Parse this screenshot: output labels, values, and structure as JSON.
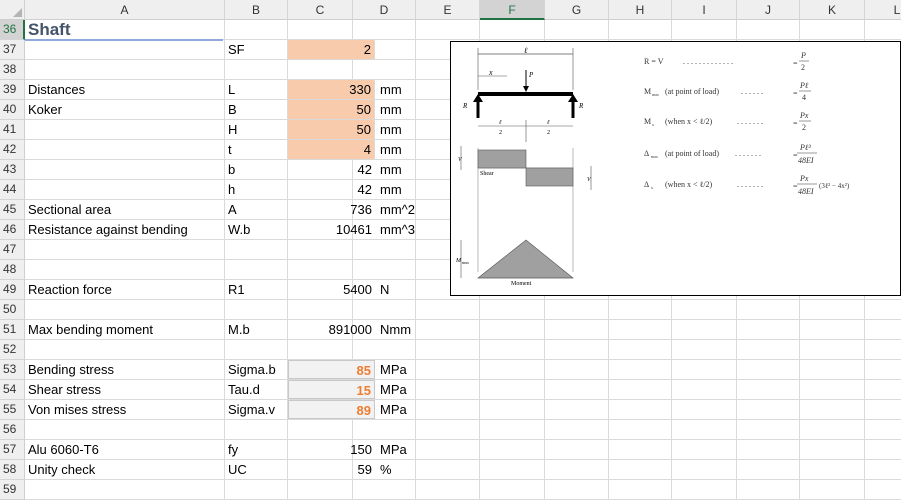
{
  "columns": [
    "A",
    "B",
    "C",
    "D",
    "E",
    "F",
    "G",
    "H",
    "I",
    "J",
    "K",
    "L"
  ],
  "selected_column": "F",
  "selected_row": "36",
  "rows": [
    {
      "num": "36",
      "a": "Shaft",
      "b": "",
      "c": "",
      "d": ""
    },
    {
      "num": "37",
      "a": "",
      "b": "SF",
      "c": "2",
      "d": ""
    },
    {
      "num": "38",
      "a": "",
      "b": "",
      "c": "",
      "d": ""
    },
    {
      "num": "39",
      "a": "Distances",
      "b": "L",
      "c": "330",
      "d": "mm"
    },
    {
      "num": "40",
      "a": "Koker",
      "b": "B",
      "c": "50",
      "d": "mm"
    },
    {
      "num": "41",
      "a": "",
      "b": "H",
      "c": "50",
      "d": "mm"
    },
    {
      "num": "42",
      "a": "",
      "b": "t",
      "c": "4",
      "d": "mm"
    },
    {
      "num": "43",
      "a": "",
      "b": "b",
      "c": "42",
      "d": "mm"
    },
    {
      "num": "44",
      "a": "",
      "b": "h",
      "c": "42",
      "d": "mm"
    },
    {
      "num": "45",
      "a": "Sectional area",
      "b": "A",
      "c": "736",
      "d": "mm^2"
    },
    {
      "num": "46",
      "a": "Resistance against bending",
      "b": "W.b",
      "c": "10461",
      "d": "mm^3"
    },
    {
      "num": "47",
      "a": "",
      "b": "",
      "c": "",
      "d": ""
    },
    {
      "num": "48",
      "a": "",
      "b": "",
      "c": "",
      "d": ""
    },
    {
      "num": "49",
      "a": "Reaction force",
      "b": "R1",
      "c": "5400",
      "d": "N"
    },
    {
      "num": "50",
      "a": "",
      "b": "",
      "c": "",
      "d": ""
    },
    {
      "num": "51",
      "a": "Max bending moment",
      "b": "M.b",
      "c": "891000",
      "d": "Nmm"
    },
    {
      "num": "52",
      "a": "",
      "b": "",
      "c": "",
      "d": ""
    },
    {
      "num": "53",
      "a": "Bending stress",
      "b": "Sigma.b",
      "c": "85",
      "d": "MPa"
    },
    {
      "num": "54",
      "a": "Shear stress",
      "b": "Tau.d",
      "c": "15",
      "d": "MPa"
    },
    {
      "num": "55",
      "a": "Von mises stress",
      "b": "Sigma.v",
      "c": "89",
      "d": "MPa"
    },
    {
      "num": "56",
      "a": "",
      "b": "",
      "c": "",
      "d": ""
    },
    {
      "num": "57",
      "a": "Alu 6060-T6",
      "b": "fy",
      "c": "150",
      "d": "MPa"
    },
    {
      "num": "58",
      "a": "Unity check",
      "b": "UC",
      "c": "59",
      "d": "%"
    },
    {
      "num": "59",
      "a": "",
      "b": "",
      "c": "",
      "d": ""
    }
  ],
  "figure": {
    "label_l": "ℓ",
    "label_x": "x",
    "label_p": "P",
    "label_r": "R",
    "label_half_num": "ℓ",
    "label_half_den": "2",
    "label_v": "V",
    "label_shear": "Shear",
    "label_mmax": "M",
    "label_mmax_sub": "max",
    "label_moment": "Moment",
    "formulas": [
      {
        "lhs": "R = V",
        "dots": ". . . . . . . . . . . . .",
        "rhs_num": "P",
        "rhs_den": "2"
      },
      {
        "lhs": "M",
        "lhs_sub": "max",
        "lhs_rest": "(at point of load)",
        "dots": ". . . . . .",
        "rhs_num": "Pℓ",
        "rhs_den": "4"
      },
      {
        "lhs": "M",
        "lhs_sub": "x",
        "lhs_rest": "(when x < ℓ/2)",
        "dots": ". . . . . . .",
        "rhs_num": "Px",
        "rhs_den": "2"
      },
      {
        "lhs": "Δ",
        "lhs_sub": "max",
        "lhs_rest": "(at point of load)",
        "dots": ". . . . . . .",
        "rhs_num": "Pℓ³",
        "rhs_den": "48EI"
      },
      {
        "lhs": "Δ",
        "lhs_sub": "x",
        "lhs_rest": "(when x < ℓ/2)",
        "dots": ". . . . . . .",
        "rhs_num": "Px",
        "rhs_den": "48EI",
        "rhs_tail": "(3ℓ² − 4x²)"
      }
    ]
  }
}
